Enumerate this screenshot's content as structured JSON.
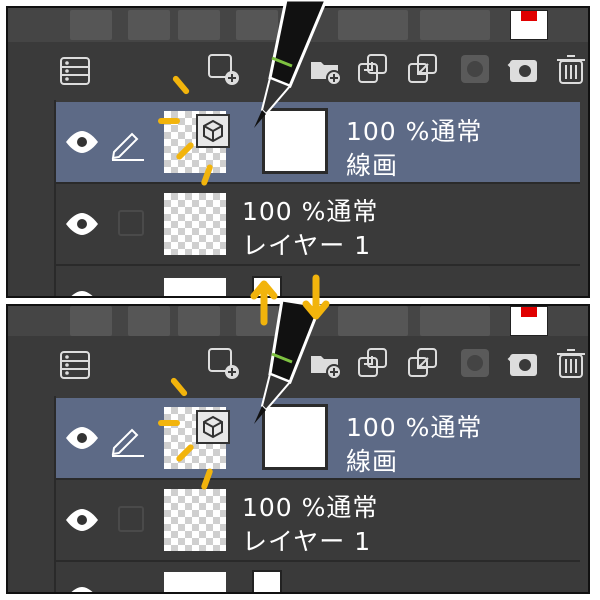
{
  "panels": [
    {
      "id": "top",
      "layers": [
        {
          "opacity_blend": "100 %通常",
          "name": "線画",
          "selected": true
        },
        {
          "opacity_blend": "100 %通常",
          "name": "レイヤー 1",
          "selected": false
        }
      ]
    },
    {
      "id": "bottom",
      "layers": [
        {
          "opacity_blend": "100 %通常",
          "name": "線画",
          "selected": true
        },
        {
          "opacity_blend": "100 %通常",
          "name": "レイヤー 1",
          "selected": false
        }
      ]
    }
  ],
  "colors": {
    "panel_bg": "#3a3a3a",
    "selected_row": "#5d6a86",
    "highlight_rays": "#f2b40c",
    "arrows": "#f2b40c",
    "accent_red": "#e00000"
  },
  "icons": [
    "layer-property-icon",
    "new-raster-layer-icon",
    "new-vector-layer-icon",
    "new-folder-icon",
    "transfer-to-lower-layer-icon",
    "combine-with-layer-below-icon",
    "mask-icon",
    "mask-selection-icon",
    "trash-icon",
    "eye-icon",
    "pencil-icon",
    "3d-cube-icon",
    "stylus-pen-icon",
    "up-arrow-icon",
    "down-arrow-icon"
  ]
}
